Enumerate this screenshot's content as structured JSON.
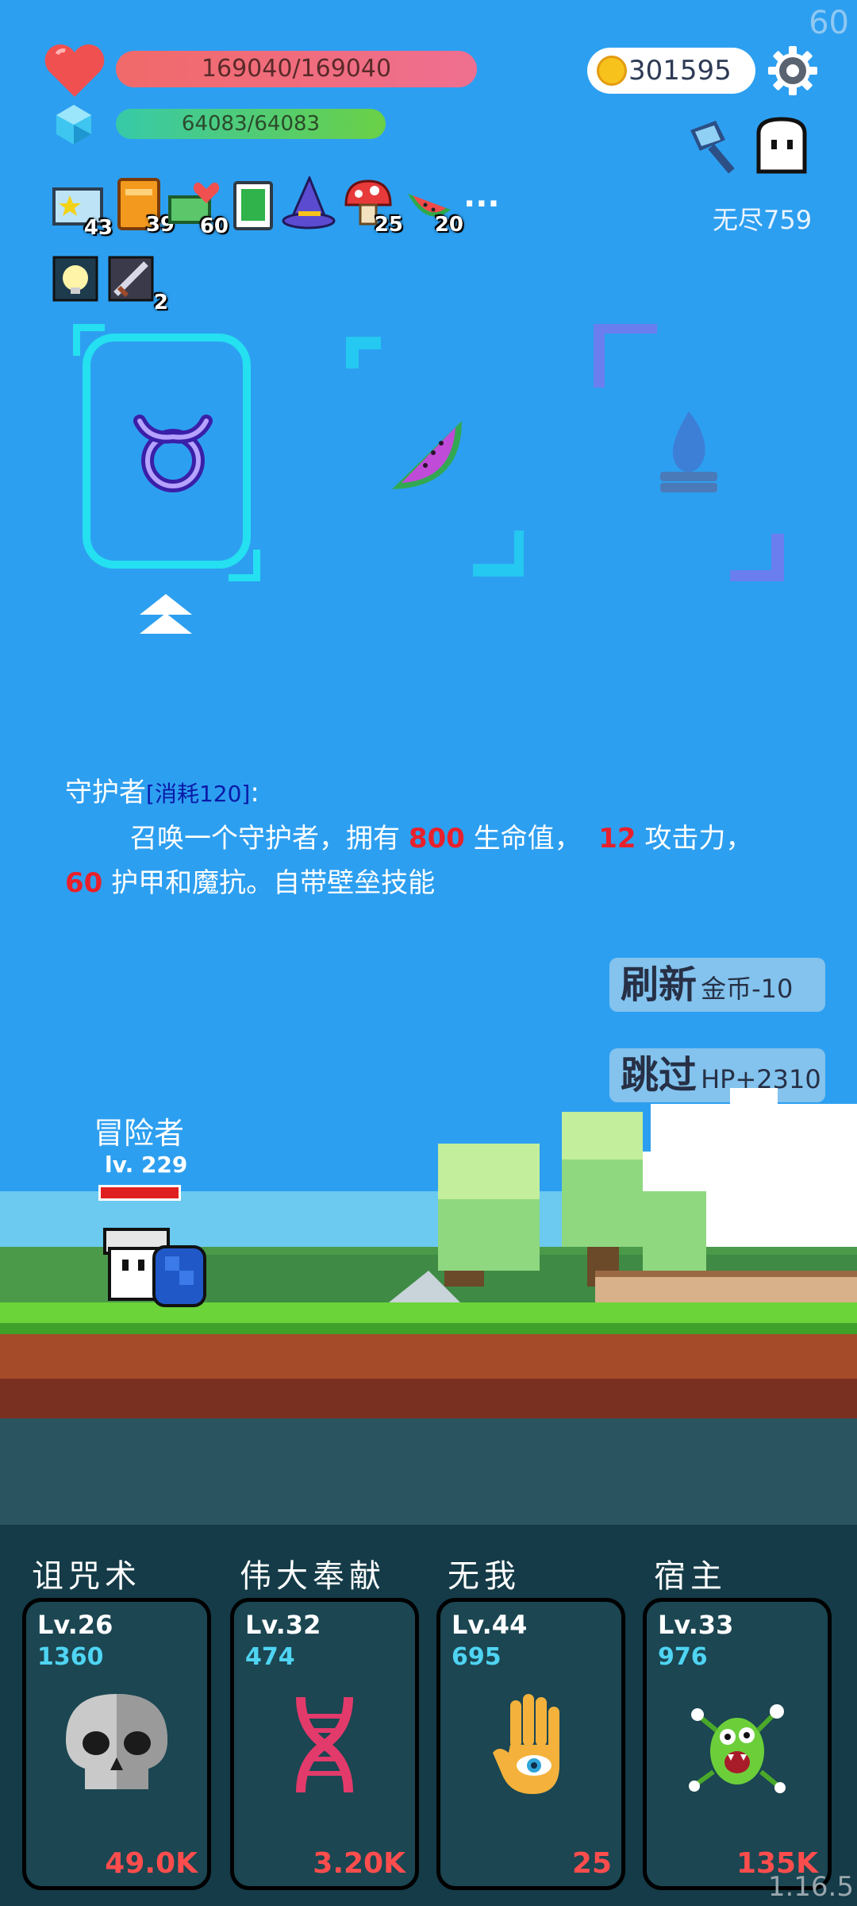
{
  "fps": "60",
  "version": "1.16.5",
  "player": {
    "hp": "169040/169040",
    "mp": "64083/64083"
  },
  "gold": "301595",
  "stage": "无尽759",
  "items": [
    {
      "icon": "star-photo-icon",
      "count": "43"
    },
    {
      "icon": "book-icon",
      "count": "39"
    },
    {
      "icon": "heart-money-icon",
      "count": "60"
    },
    {
      "icon": "green-card-icon",
      "count": ""
    },
    {
      "icon": "wizard-hat-icon",
      "count": ""
    },
    {
      "icon": "mushroom-icon",
      "count": "25"
    },
    {
      "icon": "watermelon-icon",
      "count": "20"
    }
  ],
  "more_label": "···",
  "buffs": [
    {
      "icon": "lamp-icon",
      "count": ""
    },
    {
      "icon": "sword-icon",
      "count": "2"
    }
  ],
  "choices": [
    {
      "icon": "taurus-icon"
    },
    {
      "icon": "watermelon-icon"
    },
    {
      "icon": "campfire-icon"
    }
  ],
  "description": {
    "name": "守护者",
    "cost": "消耗120",
    "colon": ":",
    "line1a": "召唤一个守护者，拥有",
    "hp_value": "800",
    "line1b": "生命值，",
    "atk_value": "12",
    "line1c": "攻击力，",
    "armor_value": "60",
    "line2": "护甲和魔抗。自带壁垒技能"
  },
  "buttons": {
    "refresh": "刷新",
    "refresh_cost": "金币-10",
    "skip": "跳过",
    "skip_reward": "HP+2310"
  },
  "hero": {
    "name": "冒险者",
    "level": "lv. 229",
    "hp_fraction": 1.0
  },
  "skills": [
    {
      "name": "诅咒术",
      "level": "Lv.26",
      "cost": "1360",
      "value": "49.0K",
      "icon": "skull-icon"
    },
    {
      "name": "伟大奉献",
      "level": "Lv.32",
      "cost": "474",
      "value": "3.20K",
      "icon": "dna-icon"
    },
    {
      "name": "无我",
      "level": "Lv.44",
      "cost": "695",
      "value": "25",
      "icon": "eye-hand-icon"
    },
    {
      "name": "宿主",
      "level": "Lv.33",
      "cost": "976",
      "value": "135K",
      "icon": "green-monster-icon"
    }
  ]
}
